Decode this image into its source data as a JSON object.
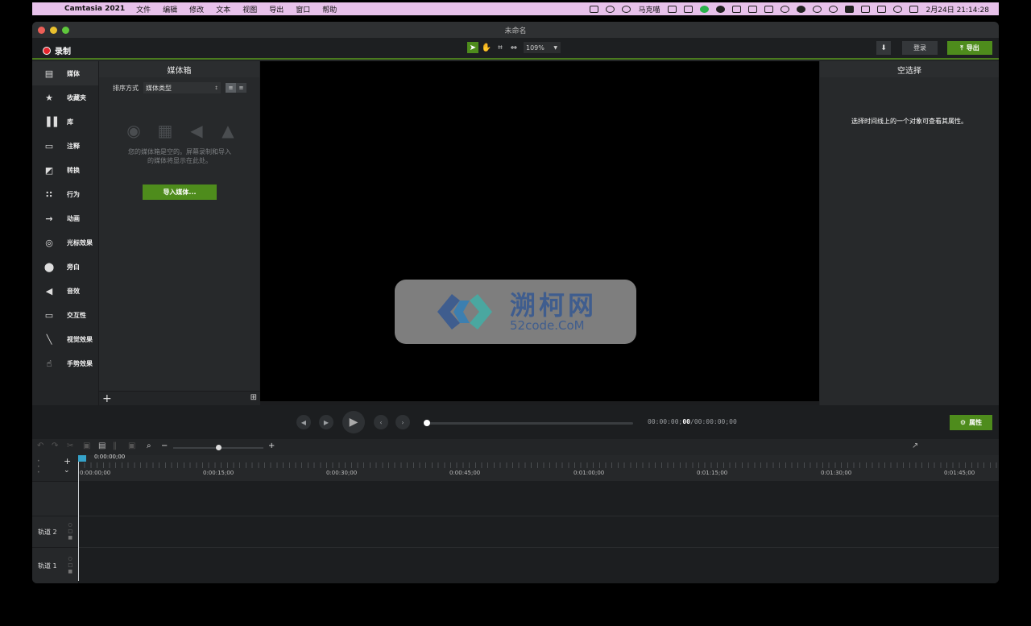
{
  "menubar": {
    "apple": "",
    "app_name": "Camtasia 2021",
    "items": [
      "文件",
      "编辑",
      "修改",
      "文本",
      "视图",
      "导出",
      "窗口",
      "帮助"
    ],
    "status_text": "马克喵",
    "datetime": "2月24日  21:14:28"
  },
  "window": {
    "title": "未命名"
  },
  "toolbar": {
    "record_label": "录制",
    "zoom_value": "109%",
    "login_label": "登录",
    "export_label": "导出"
  },
  "leftnav": {
    "items": [
      {
        "label": "媒体",
        "icon": "media-icon"
      },
      {
        "label": "收藏夹",
        "icon": "star-icon"
      },
      {
        "label": "库",
        "icon": "library-icon"
      },
      {
        "label": "注释",
        "icon": "annotation-icon"
      },
      {
        "label": "转换",
        "icon": "transition-icon"
      },
      {
        "label": "行为",
        "icon": "behavior-icon"
      },
      {
        "label": "动画",
        "icon": "animation-icon"
      },
      {
        "label": "光标效果",
        "icon": "cursor-effect-icon"
      },
      {
        "label": "旁白",
        "icon": "microphone-icon"
      },
      {
        "label": "音效",
        "icon": "speaker-icon"
      },
      {
        "label": "交互性",
        "icon": "interactivity-icon"
      },
      {
        "label": "视觉效果",
        "icon": "magic-wand-icon"
      },
      {
        "label": "手势效果",
        "icon": "gesture-icon"
      }
    ]
  },
  "mediabin": {
    "title": "媒体箱",
    "sort_label": "排序方式",
    "sort_value": "媒体类型",
    "empty_line1": "您的媒体箱是空的。屏幕录制和导入",
    "empty_line2": "的媒体将显示在此处。",
    "import_label": "导入媒体..."
  },
  "watermark": {
    "big_text": "溯柯网",
    "small_text": "52code.CoM"
  },
  "properties": {
    "title": "空选择",
    "message": "选择时间线上的一个对象可查看其属性。"
  },
  "transport": {
    "time_current_prefix": "00:00:00;",
    "time_current_frames": "00",
    "time_total": "/00:00:00;00",
    "properties_label": "属性"
  },
  "timeline": {
    "playhead_time": "0:00:00;00",
    "ruler_labels": [
      "0:00:00;00",
      "0:00:15;00",
      "0:00:30;00",
      "0:00:45;00",
      "0:01:00;00",
      "0:01:15;00",
      "0:01:30;00",
      "0:01:45;00"
    ],
    "tracks": [
      "轨道 2",
      "轨道 1"
    ]
  },
  "colors": {
    "accent_green": "#4e8c1c",
    "record_red": "#e3262e",
    "menubar_bg": "#e7c1ea"
  }
}
